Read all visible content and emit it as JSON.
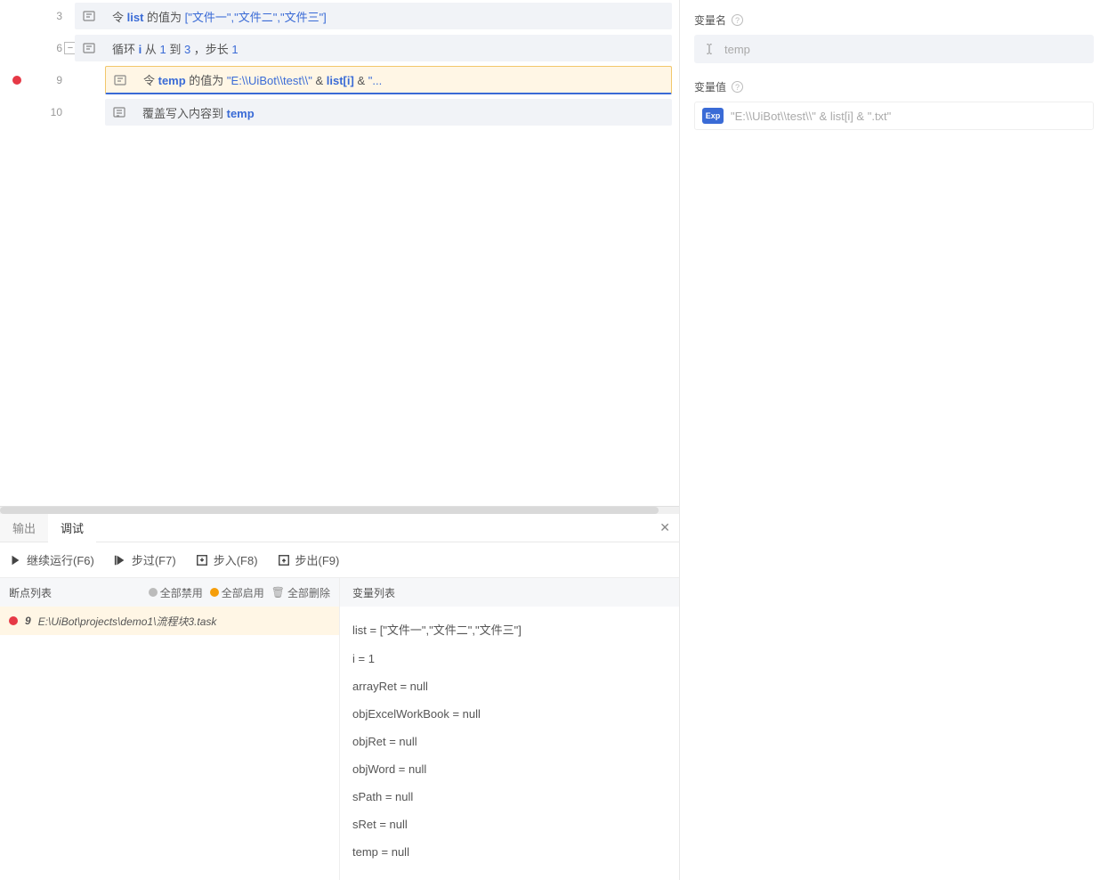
{
  "code": {
    "lines": [
      {
        "num": "3",
        "indent": 1,
        "icon": "assign",
        "parts": [
          "令 ",
          {
            "t": "ident",
            "v": "list"
          },
          " 的值为 ",
          {
            "t": "str",
            "v": "[\"文件一\",\"文件二\",\"文件三\"]"
          }
        ]
      },
      {
        "num": "6",
        "fold": true,
        "indent": 1,
        "icon": "assign",
        "parts": [
          "循环 ",
          {
            "t": "ident",
            "v": "i"
          },
          " 从 ",
          {
            "t": "num",
            "v": "1"
          },
          " 到 ",
          {
            "t": "num",
            "v": "3"
          },
          " ，步长 ",
          {
            "t": "num",
            "v": "1"
          }
        ]
      },
      {
        "num": "9",
        "breakpoint": true,
        "indent": 2,
        "icon": "assign",
        "selected": true,
        "parts": [
          "令 ",
          {
            "t": "ident",
            "v": "temp"
          },
          " 的值为 ",
          {
            "t": "str",
            "v": "\"E:\\\\UiBot\\\\test\\\\\""
          },
          " & ",
          {
            "t": "ident",
            "v": "list[i]"
          },
          " & ",
          {
            "t": "str",
            "v": "\"..."
          }
        ]
      },
      {
        "num": "10",
        "indent": 2,
        "icon": "write",
        "parts": [
          "覆盖写入内容到 ",
          {
            "t": "ident",
            "v": "temp"
          }
        ]
      }
    ]
  },
  "bottom": {
    "tabs": [
      "输出",
      "调试"
    ],
    "activeTab": 1,
    "toolbar": [
      {
        "icon": "play",
        "label": "继续运行(F6)"
      },
      {
        "icon": "step-over",
        "label": "步过(F7)"
      },
      {
        "icon": "step-in",
        "label": "步入(F8)"
      },
      {
        "icon": "step-out",
        "label": "步出(F9)"
      }
    ],
    "bp": {
      "title": "断点列表",
      "disableAll": "全部禁用",
      "enableAll": "全部启用",
      "deleteAll": "全部删除",
      "items": [
        {
          "line": "9",
          "path": "E:\\UiBot\\projects\\demo1\\流程块3.task"
        }
      ]
    },
    "vars": {
      "title": "变量列表",
      "items": [
        "list = [\"文件一\",\"文件二\",\"文件三\"]",
        "i = 1",
        "arrayRet = null",
        "objExcelWorkBook = null",
        "objRet = null",
        "objWord = null",
        "sPath = null",
        "sRet = null",
        "temp = null"
      ]
    }
  },
  "props": {
    "nameLabel": "变量名",
    "nameValue": "temp",
    "valueLabel": "变量值",
    "valueValue": "\"E:\\\\UiBot\\\\test\\\\\" & list[i] & \".txt\"",
    "expChip": "Exp"
  }
}
